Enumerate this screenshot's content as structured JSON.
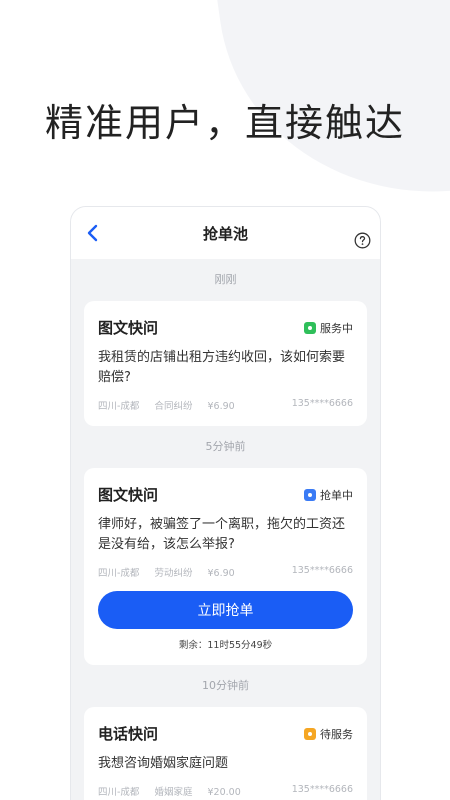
{
  "headline": "精准用户，直接触达",
  "navbar": {
    "title": "抢单池"
  },
  "sections": [
    {
      "time": "刚刚",
      "card": {
        "title": "图文快问",
        "status": "服务中",
        "status_color": "#2fbf5a",
        "text": "我租赁的店铺出租方违约收回，该如何索要赔偿?",
        "location": "四川-成都",
        "category": "合同纠纷",
        "price": "¥6.90",
        "phone": "135****6666"
      }
    },
    {
      "time": "5分钟前",
      "card": {
        "title": "图文快问",
        "status": "抢单中",
        "status_color": "#3a7bf5",
        "text": "律师好，被骗签了一个离职，拖欠的工资还是没有给，该怎么举报?",
        "location": "四川-成都",
        "category": "劳动纠纷",
        "price": "¥6.90",
        "phone": "135****6666",
        "button_label": "立即抢单",
        "remaining": "剩余：11时55分49秒"
      }
    },
    {
      "time": "10分钟前",
      "card": {
        "title": "电话快问",
        "status": "待服务",
        "status_color": "#f5a623",
        "text": "我想咨询婚姻家庭问题",
        "location": "四川-成都",
        "category": "婚姻家庭",
        "price": "¥20.00",
        "phone": "135****6666"
      }
    }
  ]
}
